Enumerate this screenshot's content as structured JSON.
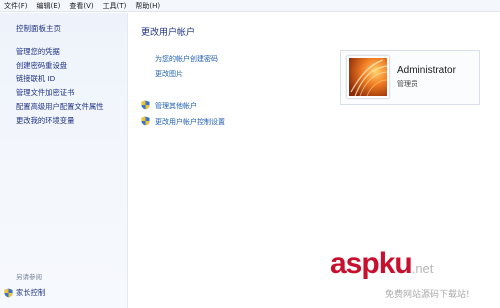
{
  "menu": [
    "文件(F)",
    "编辑(E)",
    "查看(V)",
    "工具(T)",
    "帮助(H)"
  ],
  "sidebar": {
    "home": "控制面板主页",
    "links": [
      "管理您的凭据",
      "创建密码重设盘",
      "链接联机 ID",
      "管理文件加密证书",
      "配置高级用户配置文件属性",
      "更改我的环境变量"
    ],
    "see_also": "另请参阅",
    "family_safety": "家长控制"
  },
  "main": {
    "title": "更改用户帐户",
    "tasks": [
      "为您的帐户创建密码",
      "更改图片",
      "管理其他帐户",
      "更改用户帐户控制设置"
    ]
  },
  "account": {
    "name": "Administrator",
    "role": "管理员"
  },
  "watermark": {
    "logo": "aspku",
    "suffix": ".net",
    "sub": "免费网站源码下载站!"
  },
  "colors": {
    "link": "#1e3287",
    "task_link": "#1e5fb4",
    "watermark": "#c8102e"
  },
  "icons": {
    "uac": "shield-icon",
    "avatar_art": "flower-icon"
  }
}
